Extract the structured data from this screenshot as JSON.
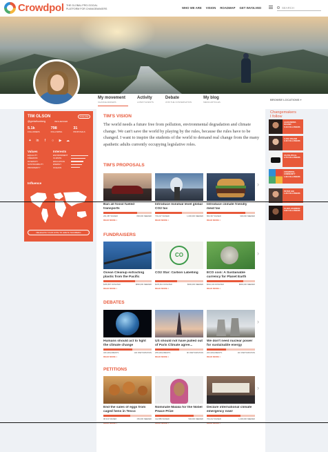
{
  "header": {
    "brand": "Crowdpol",
    "tagline": "THE GLOBAL PRO-SOCIAL PLATFORM FOR CHANGEMAKERS",
    "nav": [
      "WHO WE ARE",
      "VISION",
      "ROADMAP",
      "GET INVOLVED"
    ],
    "search_placeholder": "SEARCH"
  },
  "profile_tabs": [
    {
      "label": "My movement",
      "sub": "CHANGE-MAKERS",
      "active": true
    },
    {
      "label": "Activity",
      "sub": "LATEST EVENTS",
      "active": false
    },
    {
      "label": "Debate",
      "sub": "JOIN THE CONVERSATION",
      "active": false
    },
    {
      "label": "My blog",
      "sub": "MEDIA ARTICLES",
      "active": false
    }
  ],
  "browse_label": "BROWSE LOCATIONS",
  "profile": {
    "name": "TIM OLSON",
    "handle": "@gretathunberg",
    "badge": "INFLUENCER",
    "follow_label": "FOLLOW",
    "stats": [
      {
        "value": "5.1k",
        "label": "FOLLOWERS"
      },
      {
        "value": "798",
        "label": "FOLLOWING"
      },
      {
        "value": "31",
        "label": "PROPOSALS"
      }
    ],
    "social_icons": [
      "twitter-icon",
      "linkedin-icon",
      "facebook-icon",
      "instagram-icon",
      "youtube-icon",
      "soundcloud-icon"
    ],
    "values_title": "Values",
    "values": [
      "EQUALITY",
      "FREEDOM",
      "DIVERSITY",
      "SUSTAINABILITY",
      "PROSPERITY"
    ],
    "interests_title": "Interests",
    "interests": [
      {
        "label": "ENVIRONMENT",
        "level": 0.95
      },
      {
        "label": "CLIMATE",
        "level": 0.8
      },
      {
        "label": "EDUCATION",
        "level": 0.7
      },
      {
        "label": "ENERGY",
        "level": 0.6
      },
      {
        "label": "OCEANS",
        "level": 0.5
      }
    ],
    "influence_title": "Influence",
    "cta": "DELEGATE YOUR VOTE TO GRETA THUNBERG"
  },
  "vision": {
    "title": "TIM'S VISION",
    "text": "The world needs a future free from pollution, environmental degradation and climate change. We can't save the world by playing by the rules, because the rules have to be changed. I want to inspire the students of the world to demand real change from the many apathetic adults currently occupying legislative roles."
  },
  "sections": [
    {
      "title": "TIM'S PROPOSALS",
      "cards": [
        {
          "title": "Ban all fossil fueled transports",
          "progress": 0.7,
          "meta": [
            "201,387 SIGNED",
            "800,000 NEEDED"
          ],
          "more": "READ MORE >"
        },
        {
          "title": "Introduce minimal level global CO2 tax",
          "progress": 0.55,
          "meta": [
            "739,227 SIGNED",
            "1,000,000 NEEDED"
          ],
          "more": "READ MORE >"
        },
        {
          "title": "Introduce climate friendly meat tax",
          "progress": 0.8,
          "meta": [
            "863,397 SIGNED",
            "900,000 NEEDED"
          ],
          "more": "READ MORE >"
        }
      ]
    },
    {
      "title": "FUNDRAISERS",
      "cards": [
        {
          "title": "Ocean Cleanup extracting plastic from the Pacific",
          "progress": 0.65,
          "meta": [
            "$465,887 DONATED",
            "$800,000 NEEDED"
          ],
          "more": "READ MORE >"
        },
        {
          "title": "CO2 Star: Carbon Labelling",
          "progress": 0.45,
          "meta": [
            "$235,661 DONATED",
            "$600,000 NEEDED"
          ],
          "more": "READ MORE >"
        },
        {
          "title": "ECO coin: A Sustainable currency for Planet Earth",
          "progress": 0.75,
          "meta": [
            "$602,109 DONATED",
            "$800,000 NEEDED"
          ],
          "more": "READ MORE >"
        }
      ]
    },
    {
      "title": "DEBATES",
      "cards": [
        {
          "title": "Humans should act to fight the climate change",
          "progress": 0.6,
          "meta": [
            "326 ARGUMENTS",
            "14K PARTICIPATION"
          ],
          "more": "READ MORE >"
        },
        {
          "title": "US should not have pulled out of Paris Climate agree...",
          "progress": 0.5,
          "meta": [
            "258 ARGUMENTS",
            "9K PARTICIPATION"
          ],
          "more": "READ MORE >"
        },
        {
          "title": "We don't need nuclear power for sustainable energy",
          "progress": 0.4,
          "meta": [
            "200 ARGUMENTS",
            "11K PARTICIPATION"
          ],
          "more": "READ MORE >"
        }
      ]
    },
    {
      "title": "PETITIONS",
      "cards": [
        {
          "title": "End the sales of eggs from caged hens in Tesco",
          "progress": 0.55,
          "meta": [
            "98,310 SIGNED",
            "150,000 NEEDED"
          ],
          "more": "READ MORE >"
        },
        {
          "title": "Nominate Malala for the Nobel Peace Prize",
          "progress": 0.8,
          "meta": [
            "412,889 SIGNED",
            "500,000 NEEDED"
          ],
          "more": "READ MORE >"
        },
        {
          "title": "Declare international climate emergency now!",
          "progress": 0.7,
          "meta": [
            "700,212 SIGNED",
            "1,000,000 NEEDED"
          ],
          "more": "READ MORE >"
        }
      ]
    }
  ],
  "changemakers": {
    "title_line1": "Changemakers",
    "title_line2": "I follow",
    "items": [
      {
        "name": "ALEXANDRIA OCASIO",
        "sub": "5.1k FOLLOWERS"
      },
      {
        "name": "LUCIA PAGANI",
        "sub": "3.4k FOLLOWERS"
      },
      {
        "name": "US POLITICAL",
        "sub": "2.7k FOLLOWERS"
      },
      {
        "name": "CROWDPOL COMMUNITY",
        "sub": "1.9k FOLLOWERS"
      },
      {
        "name": "PETER LEE",
        "sub": "1.2k FOLLOWERS"
      },
      {
        "name": "CLARA JOHNSON",
        "sub": "0.8k FOLLOWERS"
      }
    ]
  }
}
